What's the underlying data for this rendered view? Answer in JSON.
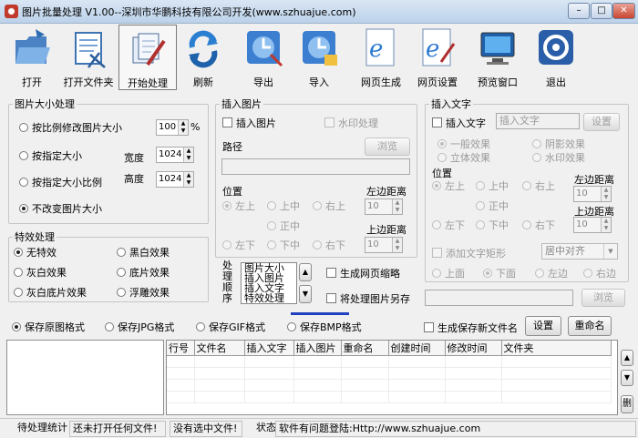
{
  "window": {
    "title": "图片批量处理 V1.00--深圳市华鹏科技有限公司开发(www.szhuajue.com)",
    "minimize": "–",
    "maximize": "□",
    "close": "✕"
  },
  "toolbar": {
    "open": "打开",
    "open_folder": "打开文件夹",
    "start": "开始处理",
    "refresh": "刷新",
    "export": "导出",
    "import": "导入",
    "web_gen": "网页生成",
    "web_settings": "网页设置",
    "preview": "预览窗口",
    "exit": "退出"
  },
  "size_panel": {
    "title": "图片大小处理",
    "opt_ratio": "按比例修改图片大小",
    "ratio_value": "100",
    "percent": "%",
    "opt_fixed": "按指定大小",
    "width_label": "宽度",
    "width_value": "1024",
    "opt_fixed_ratio": "按指定大小比例",
    "height_label": "高度",
    "height_value": "1024",
    "opt_keep": "不改变图片大小"
  },
  "effects_panel": {
    "title": "特效处理",
    "none": "无特效",
    "bw": "黑白效果",
    "gray": "灰白效果",
    "negative": "底片效果",
    "gray_negative": "灰白底片效果",
    "emboss": "浮雕效果"
  },
  "image_panel": {
    "title": "插入图片",
    "insert_check": "插入图片",
    "watermark": "水印处理",
    "path_label": "路径",
    "browse": "浏览",
    "position": "位置",
    "top_left": "左上",
    "top_center": "上中",
    "top_right": "右上",
    "center": "正中",
    "bottom_left": "左下",
    "bottom_center": "下中",
    "bottom_right": "右下",
    "left_margin": "左边距离",
    "left_value": "10",
    "top_margin": "上边距离",
    "top_value": "10"
  },
  "text_panel": {
    "title": "插入文字",
    "insert_check": "插入文字",
    "text_placeholder": "插入文字",
    "settings": "设置",
    "normal": "一般效果",
    "shadow": "阴影效果",
    "solid": "立体效果",
    "watermark": "水印效果",
    "position": "位置",
    "top_left": "左上",
    "top_center": "上中",
    "top_right": "右上",
    "center": "正中",
    "bottom_left": "左下",
    "bottom_center": "下中",
    "bottom_right": "右下",
    "left_margin": "左边距离",
    "left_value": "10",
    "top_margin": "上边距离",
    "top_value": "10",
    "add_rect": "添加文字矩形",
    "align": "居中对齐",
    "above": "上面",
    "below": "下面",
    "left": "左边",
    "right": "右边"
  },
  "order": {
    "label": [
      "处",
      "理",
      "顺",
      "序"
    ],
    "items": [
      "图片大小",
      "插入图片",
      "插入文字",
      "特效处理"
    ],
    "up": "▲",
    "down": "▼"
  },
  "options": {
    "web_thumb": "生成网页缩略",
    "save_as": "将处理图片另存",
    "browse": "浏览"
  },
  "formats": {
    "original": "保存原图格式",
    "jpg": "保存JPG格式",
    "gif": "保存GIF格式",
    "bmp": "保存BMP格式",
    "new_name": "生成保存新文件名",
    "settings": "设置",
    "rename": "重命名"
  },
  "table": {
    "columns": [
      "行号",
      "文件名",
      "插入文字",
      "插入图片",
      "重命名",
      "创建时间",
      "修改时间",
      "文件夹"
    ]
  },
  "side_buttons": {
    "up": "▲",
    "down": "▼",
    "delete": "删"
  },
  "status": {
    "pending_label": "待处理统计",
    "no_files": "还未打开任何文件!",
    "no_selection": "没有选中文件!",
    "state_label": "状态",
    "contact": "软件有问题登陆:Http://www.szhuajue.com"
  }
}
